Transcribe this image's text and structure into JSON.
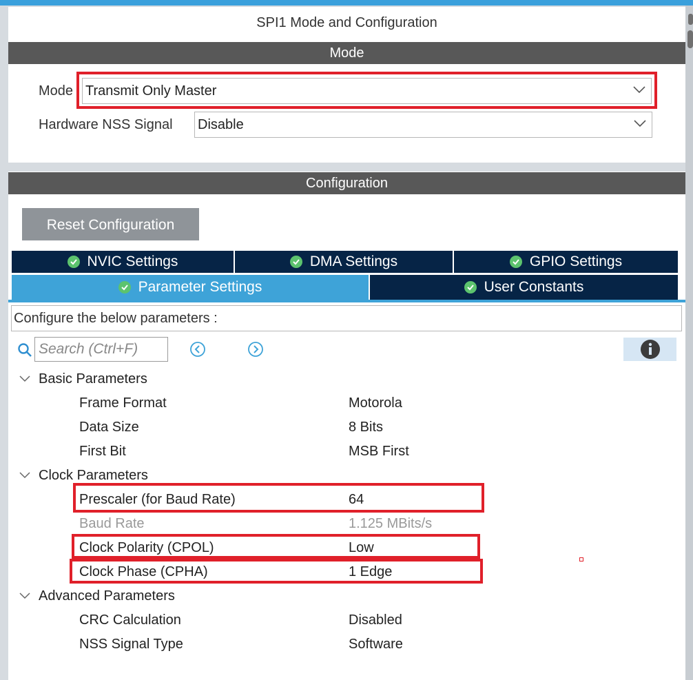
{
  "window": {
    "title": "SPI1 Mode and Configuration"
  },
  "mode_section": {
    "header": "Mode",
    "mode_label": "Mode",
    "mode_value": "Transmit Only Master",
    "nss_label": "Hardware NSS Signal",
    "nss_value": "Disable"
  },
  "config_section": {
    "header": "Configuration",
    "reset_label": "Reset Configuration",
    "tabs": [
      {
        "label": "NVIC Settings",
        "active": false
      },
      {
        "label": "DMA Settings",
        "active": false
      },
      {
        "label": "GPIO Settings",
        "active": false
      },
      {
        "label": "Parameter Settings",
        "active": true
      },
      {
        "label": "User Constants",
        "active": false
      }
    ],
    "info_text": "Configure the below parameters :",
    "search_placeholder": "Search (Ctrl+F)",
    "groups": [
      {
        "label": "Basic Parameters",
        "params": [
          {
            "name": "Frame Format",
            "value": "Motorola"
          },
          {
            "name": "Data Size",
            "value": "8 Bits"
          },
          {
            "name": "First Bit",
            "value": "MSB First"
          }
        ]
      },
      {
        "label": "Clock Parameters",
        "params": [
          {
            "name": "Prescaler (for Baud Rate)",
            "value": "64"
          },
          {
            "name": "Baud Rate",
            "value": "1.125 MBits/s",
            "disabled": true
          },
          {
            "name": "Clock Polarity (CPOL)",
            "value": "Low"
          },
          {
            "name": "Clock Phase (CPHA)",
            "value": "1 Edge"
          }
        ]
      },
      {
        "label": "Advanced Parameters",
        "params": [
          {
            "name": "CRC Calculation",
            "value": "Disabled"
          },
          {
            "name": "NSS Signal Type",
            "value": "Software"
          }
        ]
      }
    ]
  },
  "colors": {
    "accent": "#3ea3d8",
    "tab_dark": "#062446",
    "header_band": "#585858",
    "highlight": "#e0202a",
    "check": "#5cc36e"
  }
}
